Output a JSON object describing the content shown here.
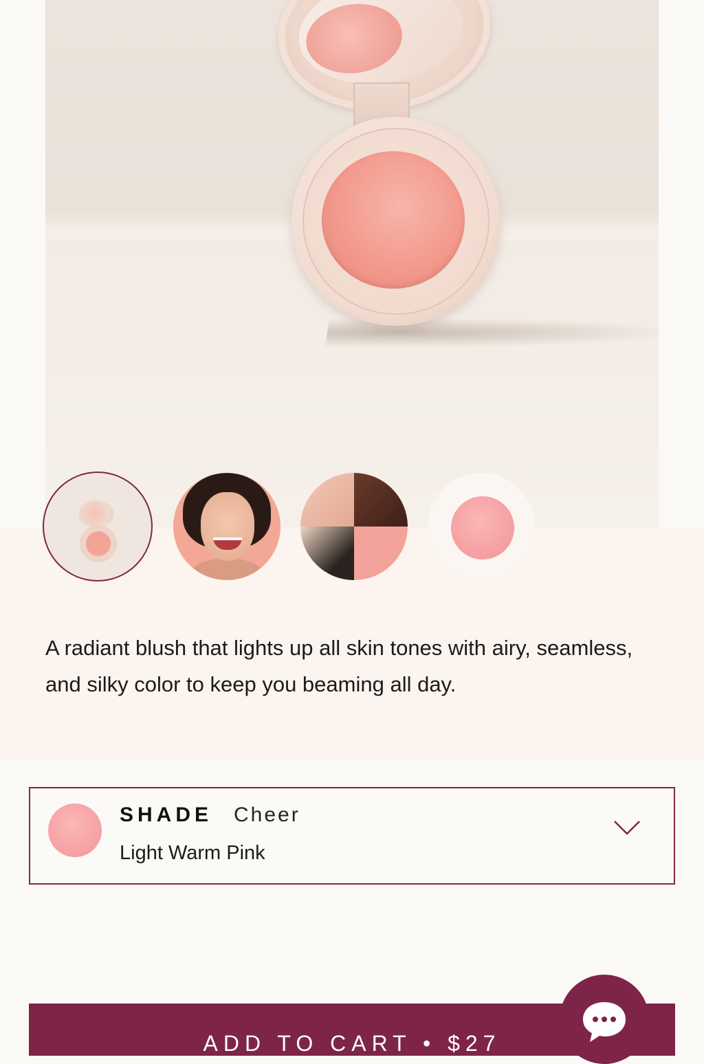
{
  "gallery": {
    "selected_index": 0,
    "thumbnails": [
      {
        "name": "product-shot"
      },
      {
        "name": "model-portrait"
      },
      {
        "name": "model-collage"
      },
      {
        "name": "swatch-closeup"
      }
    ]
  },
  "description": "A radiant blush that lights up all skin tones with airy, seamless, and silky color to keep you beaming all day.",
  "shade": {
    "label": "SHADE",
    "name": "Cheer",
    "description": "Light Warm Pink",
    "swatch_color": "#F6A6A8",
    "icon": "chevron-down-icon"
  },
  "cart": {
    "label": "ADD TO CART • $27"
  },
  "chat": {
    "icon": "chat-bubble-icon"
  },
  "colors": {
    "accent": "#7E2448",
    "page_background": "#FBF9F6",
    "band_background": "#FCF4EF"
  }
}
